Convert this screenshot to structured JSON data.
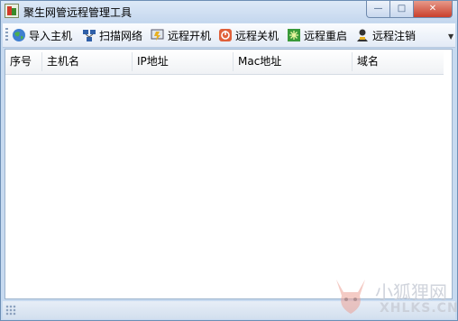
{
  "window": {
    "title": "聚生网管远程管理工具"
  },
  "title_buttons": {
    "minimize": "—",
    "maximize": "□",
    "close": "✕"
  },
  "toolbar": {
    "items": [
      {
        "label": "导入主机",
        "icon": "globe-icon"
      },
      {
        "label": "扫描网络",
        "icon": "network-scan-icon"
      },
      {
        "label": "远程开机",
        "icon": "power-on-icon"
      },
      {
        "label": "远程关机",
        "icon": "power-off-icon"
      },
      {
        "label": "远程重启",
        "icon": "restart-icon"
      },
      {
        "label": "远程注销",
        "icon": "logoff-user-icon"
      }
    ]
  },
  "table": {
    "columns": [
      "序号",
      "主机名",
      "IP地址",
      "Mac地址",
      "域名"
    ],
    "rows": []
  },
  "watermark": {
    "text_cn": "小狐狸网",
    "text_en": "XHLKS.CN"
  },
  "colors": {
    "frame": "#c7daf0",
    "close_button": "#c9402c",
    "watermark": "#c8cdd6"
  }
}
